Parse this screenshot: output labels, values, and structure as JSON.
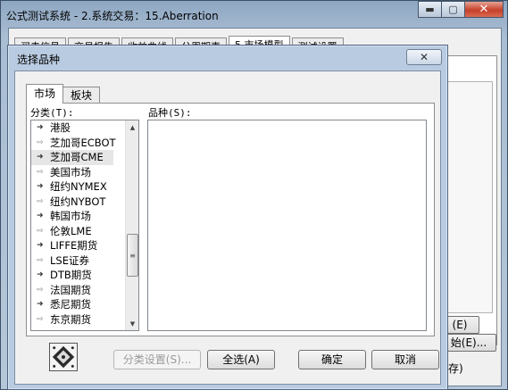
{
  "main_window": {
    "title": "公式测试系统 - 2.系统交易：15.Aberration",
    "controls": {
      "minimize": "▬",
      "maximize": "▢",
      "close": "✕"
    },
    "tabs": [
      "买卖信号",
      "交易报告",
      "收益曲线",
      "分周期表",
      "5.市场模型",
      "测试设置"
    ],
    "active_tab": 4,
    "side_button": "(E)",
    "bottom_button": "始(E)...",
    "bottom_text": "存)"
  },
  "dialog": {
    "title": "选择品种",
    "close_label": "✕",
    "tabs": {
      "market": "市场",
      "sector": "板块"
    },
    "category_label": "分类(T):",
    "variety_label": "品种(S):",
    "categories": [
      {
        "label": "港股",
        "icon": "filled"
      },
      {
        "label": "芝加哥ECBOT",
        "icon": "hollow"
      },
      {
        "label": "芝加哥CME",
        "icon": "filled",
        "selected": true
      },
      {
        "label": "美国市场",
        "icon": "hollow"
      },
      {
        "label": "纽约NYMEX",
        "icon": "filled"
      },
      {
        "label": "纽约NYBOT",
        "icon": "hollow"
      },
      {
        "label": "韩国市场",
        "icon": "filled"
      },
      {
        "label": "伦敦LME",
        "icon": "hollow"
      },
      {
        "label": "LIFFE期货",
        "icon": "filled"
      },
      {
        "label": "LSE证券",
        "icon": "hollow"
      },
      {
        "label": "DTB期货",
        "icon": "filled"
      },
      {
        "label": "法国期货",
        "icon": "hollow"
      },
      {
        "label": "悉尼期货",
        "icon": "filled"
      },
      {
        "label": "东京期货",
        "icon": "hollow"
      }
    ],
    "scroll": {
      "up": "▲",
      "down": "▼",
      "grip": "≡"
    },
    "buttons": {
      "category_settings": "分类设置(S)...",
      "select_all": "全选(A)",
      "ok": "确定",
      "cancel": "取消"
    }
  }
}
